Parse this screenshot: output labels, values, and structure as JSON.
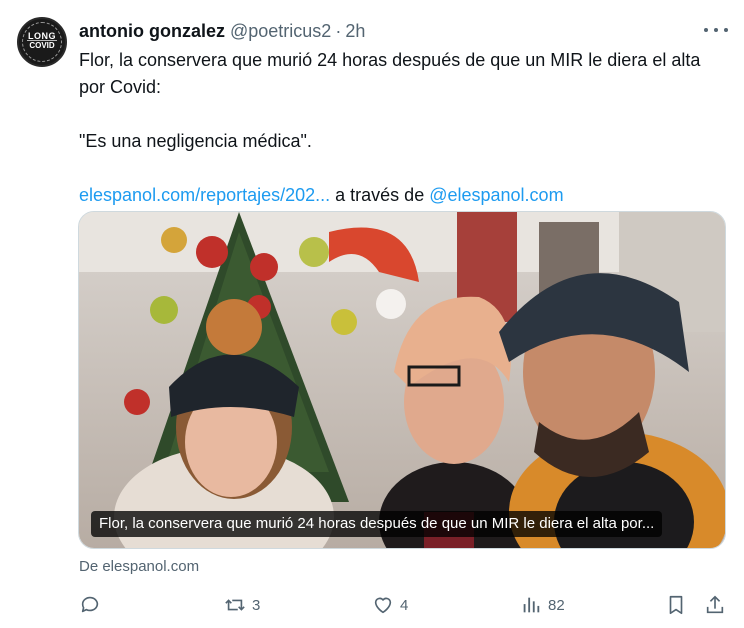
{
  "author": {
    "name": "antonio gonzalez",
    "handle": "@poetricus2",
    "separator": "·",
    "time": "2h",
    "avatar_text": [
      "LONG",
      "COVID"
    ]
  },
  "tweet": {
    "line1": "Flor, la conservera que murió 24 horas después de que un MIR le diera el alta por Covid:",
    "quote": "\"Es una negligencia médica\".",
    "link_text": "elespanol.com/reportajes/202...",
    "via_text": " a través de ",
    "mention": "@elespanol.com"
  },
  "media": {
    "caption": "Flor, la conservera que murió 24 horas después de que un MIR le diera el alta por...",
    "source": "De elespanol.com"
  },
  "actions": {
    "reply_count": "",
    "retweet_count": "3",
    "like_count": "4",
    "views_count": "82"
  },
  "icons": [
    "more-icon",
    "reply-icon",
    "retweet-icon",
    "like-icon",
    "views-icon",
    "bookmark-icon",
    "share-icon"
  ],
  "colors": {
    "text": "#0f1419",
    "secondary": "#536471",
    "link": "#1d9bf0"
  }
}
